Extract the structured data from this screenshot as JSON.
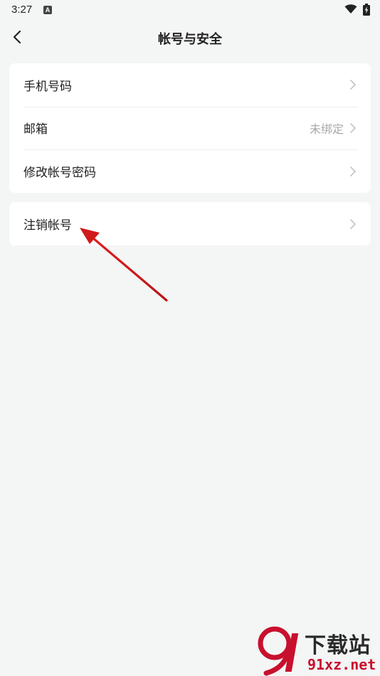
{
  "status_bar": {
    "time": "3:27",
    "notification_icon": "A"
  },
  "header": {
    "title": "帐号与安全",
    "back_icon": "chevron-left-icon"
  },
  "sections": [
    {
      "items": [
        {
          "label": "手机号码",
          "value": ""
        },
        {
          "label": "邮箱",
          "value": "未绑定"
        },
        {
          "label": "修改帐号密码",
          "value": ""
        }
      ]
    },
    {
      "items": [
        {
          "label": "注销帐号",
          "value": ""
        }
      ]
    }
  ],
  "annotation": {
    "arrow_color": "#d11a1a"
  },
  "watermark": {
    "title": "下载站",
    "url": "91xz.net"
  },
  "colors": {
    "background": "#f4f5f5",
    "card": "#ffffff",
    "secondary_text": "#a8a8a8",
    "watermark_red": "#c8102e"
  }
}
